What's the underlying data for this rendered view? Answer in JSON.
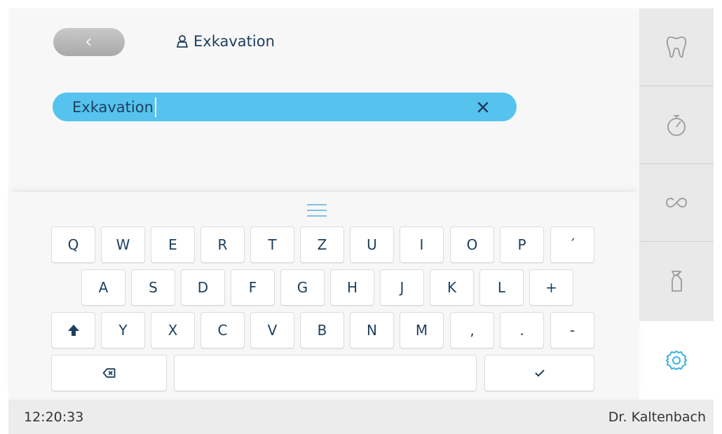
{
  "header": {
    "title": "Exkavation",
    "title_icon": "user-profile-icon",
    "back_icon": "chevron-left-icon"
  },
  "search": {
    "value": "Exkavation",
    "clear_icon": "close-icon"
  },
  "keyboard": {
    "handle_icon": "menu-lines-icon",
    "row1": [
      "Q",
      "W",
      "E",
      "R",
      "T",
      "Z",
      "U",
      "I",
      "O",
      "P",
      "´"
    ],
    "row2": [
      "A",
      "S",
      "D",
      "F",
      "G",
      "H",
      "J",
      "K",
      "L",
      "+"
    ],
    "row3": [
      "Y",
      "X",
      "C",
      "V",
      "B",
      "N",
      "M",
      ",",
      ".",
      "-"
    ],
    "shift_icon": "shift-arrow-icon",
    "backspace_icon": "backspace-icon",
    "enter_icon": "checkmark-icon",
    "space_label": ""
  },
  "sidebar": {
    "items": [
      {
        "icon": "tooth-icon"
      },
      {
        "icon": "stopwatch-icon"
      },
      {
        "icon": "infinity-loop-icon"
      },
      {
        "icon": "spray-bottle-icon"
      }
    ],
    "settings_icon": "gear-icon"
  },
  "status": {
    "time": "12:20:33",
    "user": "Dr. Kaltenbach"
  },
  "colors": {
    "accent": "#56c3ee",
    "text": "#1c3f5e",
    "icon_gray": "#9a9a9a",
    "settings": "#3bb0e0"
  }
}
